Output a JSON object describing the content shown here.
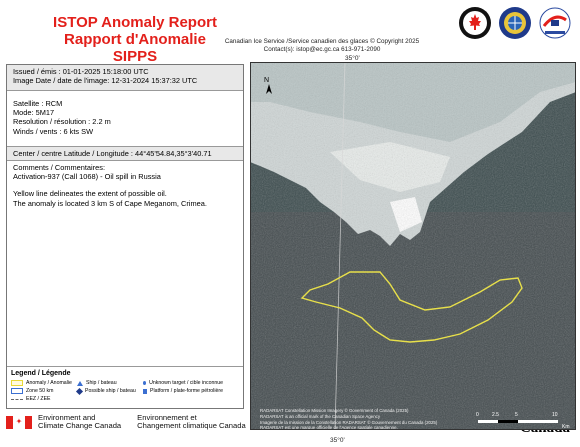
{
  "header": {
    "title_en": "ISTOP Anomaly Report",
    "title_fr": "Rapport d'Anomalie SIPPS",
    "service": "Canadian Ice Service /Service canadien des glaces © Copyright 2025",
    "contact": "Contact(s): istop@ec.gc.ca 613-971-2090"
  },
  "report": {
    "issued": "Issued / émis : 01-01-2025 15:18:00  UTC",
    "image_date": "Image Date / date de l'image: 12-31-2024 15:37:32  UTC",
    "satellite": "Satellite : RCM",
    "mode": "Mode: 5M17",
    "resolution": "Resolution / résolution : 2.2 m",
    "winds": "Winds / vents : 6 kts SW",
    "center": "Center / centre Latitude / Longitude :  44°45'54.84,35°3'40.71",
    "comments_label": "Comments / Commentaires:",
    "comment_1": "Activation-937 (Call 1068) - Oil spill in Russia",
    "comment_2": "Yellow line delineates the extent of possible oil.",
    "comment_3": "The anomaly is located 3 km S of Cape Meganom, Crimea."
  },
  "legend": {
    "title": "Legend / Légende",
    "anomaly": "Anomaly / Anomalie",
    "zone": "Zone 50 km",
    "eez": "EEZ / ZEE",
    "ship": "Ship / bateau",
    "possible_ship": "Possible ship / bateau",
    "unknown": "Unknown target / cible inconnue",
    "platform": "Platform / plate-forme pétrolière"
  },
  "footer": {
    "org_en_1": "Environment and",
    "org_en_2": "Climate Change Canada",
    "org_fr_1": "Environnement et",
    "org_fr_2": "Changement climatique Canada",
    "wordmark": "Canadä"
  },
  "map": {
    "top_coord": "35°0'",
    "bottom_coord": "35°0'",
    "north": "N",
    "credit_1": "RADARSAT Constellation Mission Imagery © Government of Canada (2025)",
    "credit_2": "RADARSAT is an official mark of the Canadian Space Agency",
    "credit_3": "Imagerie de la mission de la Constellation RADARSAT © Gouvernement du Canada (2025)",
    "credit_4": "RADARSAT est une marque officielle de l'Agence spatiale canadienne.",
    "scale_0": "0",
    "scale_1": "2.5",
    "scale_2": "5",
    "scale_3": "10",
    "scale_unit": "Km",
    "colors": {
      "land": "#cfd6d6",
      "sea": "#3a4a4c",
      "oil_outline": "#e8e04a"
    }
  }
}
